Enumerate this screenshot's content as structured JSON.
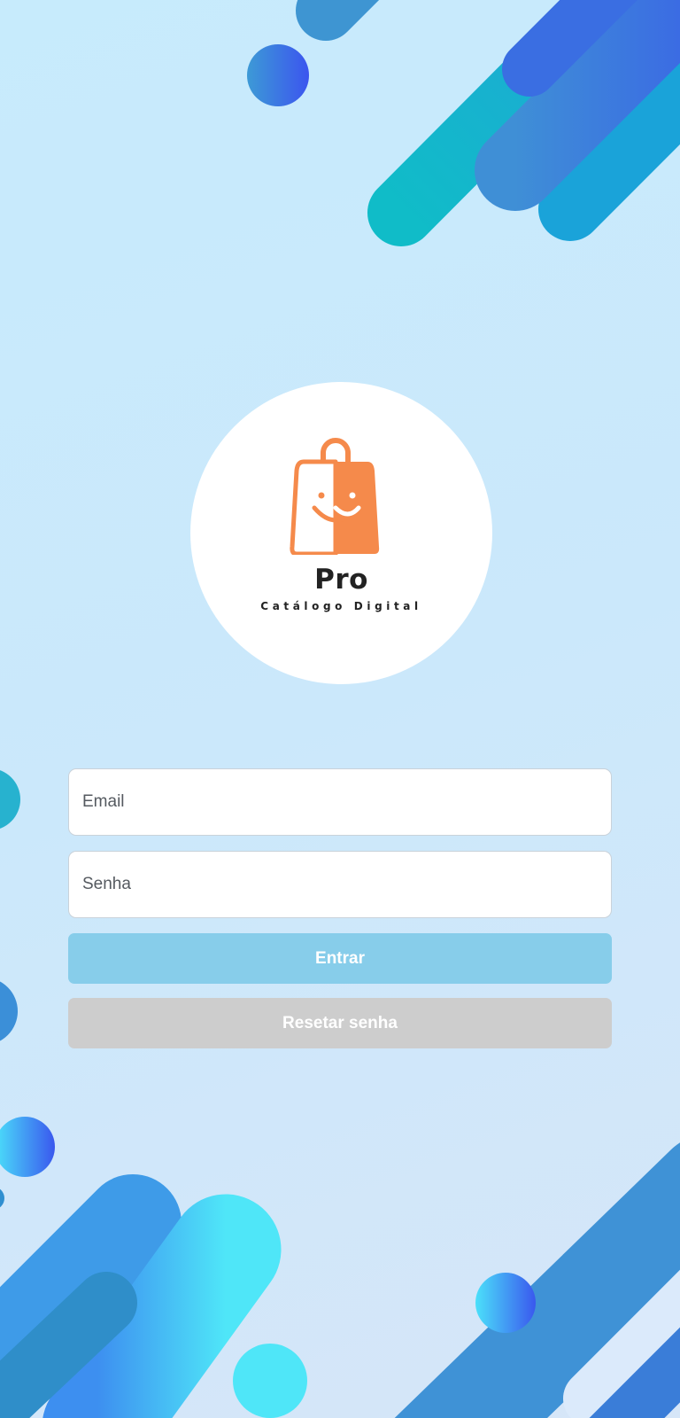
{
  "theme": {
    "background": "#c7ebfc",
    "logo_orange": "#f58a4b",
    "primary_button": "#87cdea",
    "secondary_button": "#cdcdcd"
  },
  "logo": {
    "icon": "shopping-bag-smile-icon",
    "brand": "Pro",
    "tagline": "Catálogo Digital"
  },
  "form": {
    "email_placeholder": "Email",
    "password_placeholder": "Senha",
    "login_label": "Entrar",
    "reset_label": "Resetar senha"
  }
}
